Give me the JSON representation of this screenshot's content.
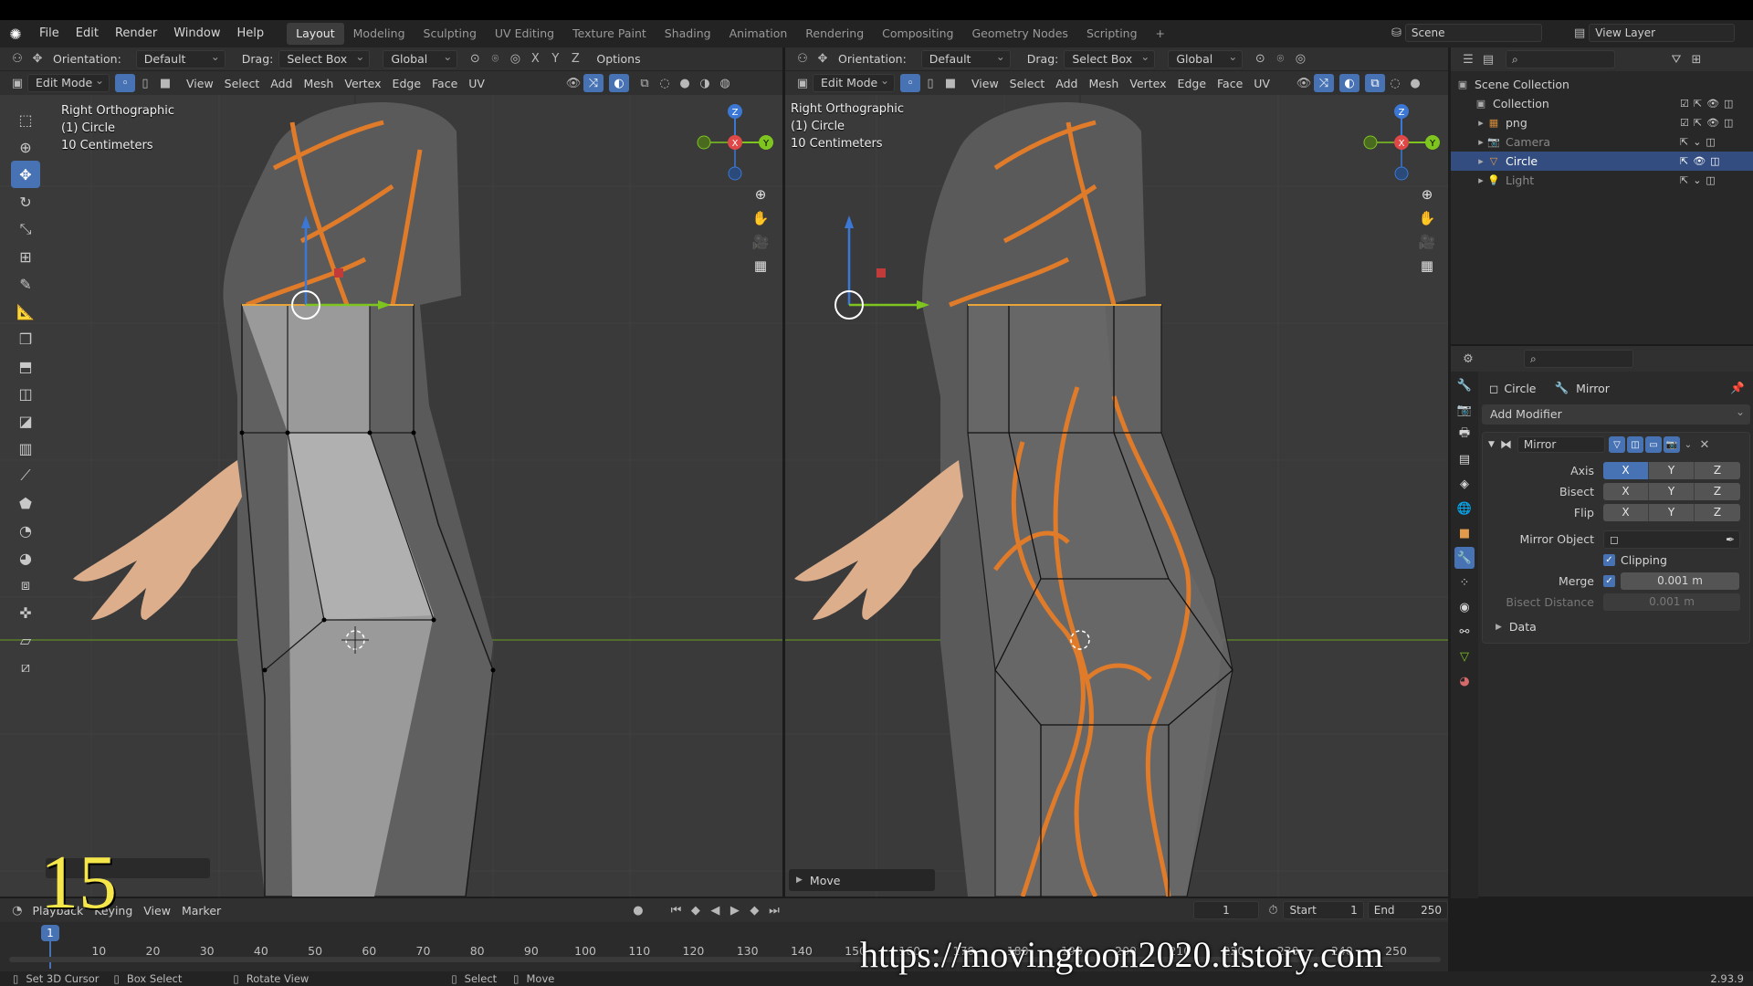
{
  "menubar": {
    "menus": [
      "File",
      "Edit",
      "Render",
      "Window",
      "Help"
    ],
    "workspaces": [
      "Layout",
      "Modeling",
      "Sculpting",
      "UV Editing",
      "Texture Paint",
      "Shading",
      "Animation",
      "Rendering",
      "Compositing",
      "Geometry Nodes",
      "Scripting"
    ],
    "active_workspace": "Layout",
    "add_tab": "+",
    "scene": "Scene",
    "view_layer": "View Layer"
  },
  "toolbar": {
    "orientation_label": "Orientation:",
    "orientation_value": "Default",
    "drag_label": "Drag:",
    "drag_value": "Select Box",
    "transform_space": "Global",
    "axes": [
      "X",
      "Y",
      "Z"
    ],
    "options": "Options"
  },
  "edit_header": {
    "mode": "Edit Mode",
    "menus": [
      "View",
      "Select",
      "Add",
      "Mesh",
      "Vertex",
      "Edge",
      "Face",
      "UV"
    ]
  },
  "viewport_left": {
    "view_name": "Right Orthographic",
    "object": "(1) Circle",
    "scale": "10 Centimeters"
  },
  "viewport_right": {
    "view_name": "Right Orthographic",
    "object": "(1) Circle",
    "scale": "10 Centimeters",
    "last_op": "Move"
  },
  "gizmo": {
    "x": "X",
    "y": "Y",
    "z": "Z"
  },
  "outliner": {
    "root": "Scene Collection",
    "items": [
      {
        "name": "Collection",
        "indent": 1,
        "selected": false
      },
      {
        "name": "png",
        "indent": 2,
        "selected": false
      },
      {
        "name": "Camera",
        "indent": 2,
        "selected": false
      },
      {
        "name": "Circle",
        "indent": 2,
        "selected": true
      },
      {
        "name": "Light",
        "indent": 2,
        "selected": false
      }
    ]
  },
  "properties": {
    "object": "Circle",
    "modifier_breadcrumb": "Mirror",
    "add_modifier": "Add Modifier",
    "modifier": {
      "name": "Mirror",
      "axis_label": "Axis",
      "bisect_label": "Bisect",
      "flip_label": "Flip",
      "axis_active": "X",
      "mirror_object_label": "Mirror Object",
      "clipping": "Clipping",
      "merge_label": "Merge",
      "merge_value": "0.001 m",
      "bisect_distance_label": "Bisect Distance",
      "bisect_distance_value": "0.001 m",
      "data_section": "Data"
    }
  },
  "timeline": {
    "menus": [
      "Playback",
      "Keying",
      "View",
      "Marker"
    ],
    "current_frame": "1",
    "start_label": "Start",
    "start": "1",
    "end_label": "End",
    "end": "250",
    "ticks": [
      "1",
      "10",
      "20",
      "30",
      "40",
      "50",
      "60",
      "70",
      "80",
      "90",
      "100",
      "110",
      "120",
      "130",
      "140",
      "150",
      "160",
      "170",
      "180",
      "190",
      "200",
      "210",
      "220",
      "230",
      "240",
      "250"
    ],
    "frame_indicator": "1"
  },
  "statusbar": {
    "items": [
      "Set 3D Cursor",
      "Box Select",
      "Rotate View",
      "Select",
      "Move"
    ],
    "version": "2.93.9"
  },
  "overlay": {
    "episode_number": "15",
    "watermark": "https://movingtoon2020.tistory.com"
  }
}
